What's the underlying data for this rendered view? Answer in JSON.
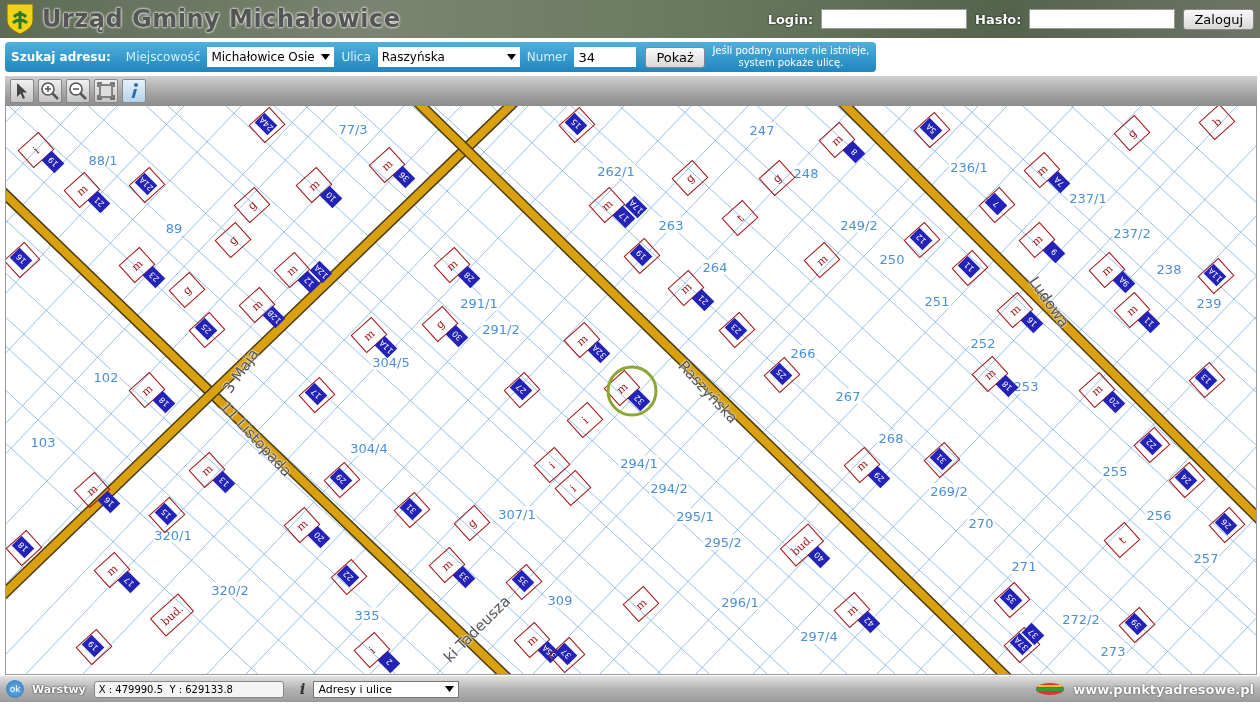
{
  "header": {
    "title": "Urząd Gminy Michałowice",
    "login_label": "Login:",
    "password_label": "Hasło:",
    "login_button": "Zaloguj"
  },
  "search": {
    "label": "Szukaj adresu:",
    "locality_label": "Miejscowość",
    "locality_value": "Michałowice Osie",
    "street_label": "Ulica",
    "street_value": "Raszyńska",
    "number_label": "Numer",
    "number_value": "34",
    "button": "Pokaż",
    "hint": "Jeśli podany numer nie istnieje,\nsystem pokaże ulicę."
  },
  "toolbar": [
    {
      "kind": "pointer",
      "selected": false
    },
    {
      "kind": "zoom-in",
      "selected": false
    },
    {
      "kind": "zoom-out",
      "selected": false
    },
    {
      "kind": "extent",
      "selected": false
    },
    {
      "kind": "info",
      "selected": true
    }
  ],
  "map": {
    "parcels": [
      {
        "label": "77/3"
      },
      {
        "label": "247"
      },
      {
        "label": "88/1"
      },
      {
        "label": "262/1"
      },
      {
        "label": "248"
      },
      {
        "label": "236/1"
      },
      {
        "label": "237/1"
      },
      {
        "label": "89"
      },
      {
        "label": "263"
      },
      {
        "label": "249/2"
      },
      {
        "label": "237/2"
      },
      {
        "label": "264"
      },
      {
        "label": "250"
      },
      {
        "label": "238"
      },
      {
        "label": "291/1"
      },
      {
        "label": "251"
      },
      {
        "label": "239"
      },
      {
        "label": "291/2"
      },
      {
        "label": "252"
      },
      {
        "label": "266"
      },
      {
        "label": "304/5"
      },
      {
        "label": "102"
      },
      {
        "label": "253"
      },
      {
        "label": "267"
      },
      {
        "label": "103"
      },
      {
        "label": "304/4"
      },
      {
        "label": "268"
      },
      {
        "label": "294/1"
      },
      {
        "label": "255"
      },
      {
        "label": "294/2"
      },
      {
        "label": "269/2"
      },
      {
        "label": "307/1"
      },
      {
        "label": "295/1"
      },
      {
        "label": "270"
      },
      {
        "label": "256"
      },
      {
        "label": "320/1"
      },
      {
        "label": "295/2"
      },
      {
        "label": "271"
      },
      {
        "label": "257"
      },
      {
        "label": "320/2"
      },
      {
        "label": "309"
      },
      {
        "label": "296/1"
      },
      {
        "label": "335"
      },
      {
        "label": "272/2"
      },
      {
        "label": "297/4"
      },
      {
        "label": "273"
      }
    ],
    "streets": [
      {
        "name": "11 Listopada"
      },
      {
        "name": "3 Maja"
      },
      {
        "name": "Raszyńska"
      },
      {
        "name": "Ludowa"
      },
      {
        "name": "ki Tadeusza"
      }
    ],
    "buildings": [
      {
        "use": "i",
        "plates": [
          "19"
        ]
      },
      {
        "use": "m",
        "plates": [
          "21"
        ]
      },
      {
        "plates": [
          "21A"
        ]
      },
      {
        "plates": [
          "24A"
        ]
      },
      {
        "use": "m",
        "plates": [
          "10"
        ]
      },
      {
        "use": "m",
        "plates": [
          "36"
        ]
      },
      {
        "plates": [
          "16"
        ]
      },
      {
        "use": "m",
        "plates": [
          "23"
        ]
      },
      {
        "use": "m",
        "plates": [
          "12",
          "12A"
        ]
      },
      {
        "use": "m",
        "plates": [
          "12B"
        ]
      },
      {
        "plates": [
          "25"
        ]
      },
      {
        "use": "m",
        "plates": [
          "28"
        ]
      },
      {
        "use": "g",
        "plates": [
          "30"
        ]
      },
      {
        "use": "m",
        "plates": [
          "11A"
        ]
      },
      {
        "use": "m",
        "plates": [
          "18"
        ]
      },
      {
        "plates": [
          "15"
        ]
      },
      {
        "use": "m",
        "plates": [
          "17",
          "17A"
        ]
      },
      {
        "plates": [
          "19"
        ]
      },
      {
        "use": "m",
        "plates": [
          "21"
        ]
      },
      {
        "plates": [
          "23"
        ]
      },
      {
        "plates": [
          "25"
        ]
      },
      {
        "use": "m",
        "plates": [
          "8"
        ]
      },
      {
        "plates": [
          "5A"
        ]
      },
      {
        "use": "m",
        "plates": [
          "7A"
        ]
      },
      {
        "plates": [
          "7"
        ]
      },
      {
        "use": "m",
        "plates": [
          "9"
        ]
      },
      {
        "use": "m",
        "plates": [
          "9A"
        ]
      },
      {
        "use": "m",
        "plates": [
          "11"
        ]
      },
      {
        "plates": [
          "11A"
        ]
      },
      {
        "use": "m",
        "plates": [
          "16"
        ]
      },
      {
        "use": "m",
        "plates": [
          "18"
        ]
      },
      {
        "use": "m",
        "plates": [
          "20"
        ]
      },
      {
        "plates": [
          "13"
        ]
      },
      {
        "plates": [
          "12"
        ]
      },
      {
        "plates": [
          "11"
        ]
      },
      {
        "use": "m",
        "plates": [
          "32"
        ]
      },
      {
        "plates": [
          "27"
        ]
      },
      {
        "use": "m",
        "plates": [
          "32A"
        ]
      },
      {
        "plates": [
          "17"
        ]
      },
      {
        "plates": [
          "29"
        ]
      },
      {
        "plates": [
          "31"
        ]
      },
      {
        "use": "m",
        "plates": [
          "33"
        ]
      },
      {
        "plates": [
          "35"
        ]
      },
      {
        "use": "m",
        "plates": [
          "35A"
        ]
      },
      {
        "plates": [
          "37"
        ]
      },
      {
        "use": "bud.",
        "plates": [
          "40"
        ]
      },
      {
        "use": "m",
        "plates": [
          "42"
        ]
      },
      {
        "use": "bud."
      },
      {
        "use": "m",
        "plates": [
          "13"
        ]
      },
      {
        "use": "m",
        "plates": [
          "16"
        ]
      },
      {
        "plates": [
          "15"
        ]
      },
      {
        "use": "m",
        "plates": [
          "20"
        ]
      },
      {
        "plates": [
          "22"
        ]
      },
      {
        "use": "m",
        "plates": [
          "17"
        ]
      },
      {
        "plates": [
          "19"
        ]
      },
      {
        "use": "i",
        "plates": [
          "2"
        ]
      },
      {
        "plates": [
          "18"
        ]
      },
      {
        "use": "m",
        "plates": [
          "29"
        ]
      },
      {
        "plates": [
          "31"
        ]
      },
      {
        "plates": [
          "35"
        ]
      },
      {
        "plates": [
          "37A",
          "37"
        ]
      },
      {
        "plates": [
          "39"
        ]
      },
      {
        "plates": [
          "22"
        ]
      },
      {
        "plates": [
          "24"
        ]
      },
      {
        "plates": [
          "26"
        ]
      },
      {
        "use": "i"
      },
      {
        "use": "i"
      },
      {
        "use": "i"
      },
      {
        "use": "g"
      },
      {
        "use": "m"
      },
      {
        "use": "t"
      },
      {
        "use": "t"
      },
      {
        "use": "g"
      },
      {
        "use": "g"
      },
      {
        "use": "b"
      },
      {
        "use": "g"
      },
      {
        "use": "g"
      },
      {
        "use": "g"
      },
      {
        "use": "g"
      },
      {
        "use": "m"
      }
    ]
  },
  "status_bar": {
    "ok": "ok",
    "layers_label": "Warstwy",
    "coordinates": "X : 479990.5  Y : 629133.8",
    "info": "i",
    "layer_select": "Adresy i ulice",
    "site": "www.punktyadresowe.pl"
  }
}
